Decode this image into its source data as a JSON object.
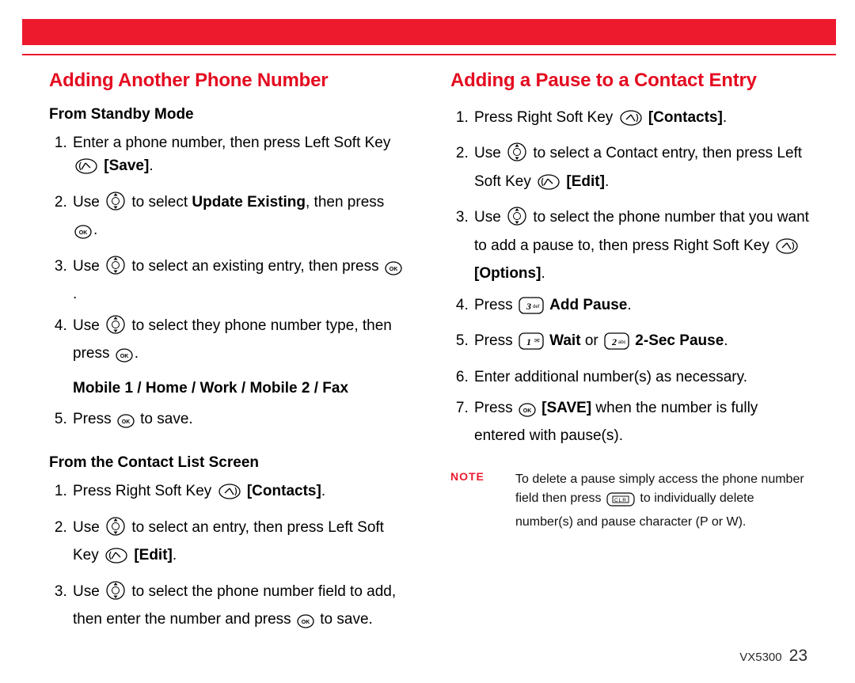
{
  "left": {
    "title": "Adding Another Phone Number",
    "sub1": "From Standby Mode",
    "steps1": {
      "s1a": "Enter a phone number, then press Left Soft Key ",
      "s1_save": "[Save]",
      "s2a": "Use ",
      "s2b": " to select ",
      "s2_update": "Update Existing",
      "s2c": ", then press ",
      "s3a": "Use ",
      "s3b": " to select an existing entry, then press ",
      "s4a": "Use ",
      "s4b": " to select they phone number type, then press ",
      "types": "Mobile 1 / Home / Work / Mobile 2 / Fax",
      "s5a": "Press ",
      "s5b": " to save."
    },
    "sub2": "From the Contact List Screen",
    "steps2": {
      "s1a": "Press Right Soft Key ",
      "s1_contacts": "[Contacts]",
      "s2a": "Use ",
      "s2b": " to select an entry, then press Left Soft Key ",
      "s2_edit": "[Edit]",
      "s3a": "Use ",
      "s3b": " to select the phone number field to add, then enter the number and press ",
      "s3c": " to save."
    }
  },
  "right": {
    "title": "Adding a Pause to a Contact Entry",
    "steps": {
      "s1a": "Press Right Soft Key ",
      "s1_contacts": "[Contacts]",
      "s2a": "Use ",
      "s2b": " to select a Contact entry, then press Left Soft Key ",
      "s2_edit": "[Edit]",
      "s3a": "Use ",
      "s3b": " to select the phone number that you want to add a pause to, then press Right Soft Key ",
      "s3_options": "[Options]",
      "s4a": "Press ",
      "s4_key": "3 def",
      "s4_addpause": " Add Pause",
      "s5a": "Press ",
      "s5_key1": "1",
      "s5_wait": " Wait",
      "s5_or": " or ",
      "s5_key2": "2 abc",
      "s5_2sec": " 2-Sec Pause",
      "s6": "Enter additional number(s) as necessary.",
      "s7a": "Press ",
      "s7_save": " [SAVE]",
      "s7b": " when the number is fully entered with pause(s)."
    },
    "note_label": "NOTE",
    "note_a": "To delete a pause simply access the phone number field then press ",
    "note_b": " to individually delete number(s) and pause character (P or W)."
  },
  "footer": {
    "model": "VX5300",
    "page": "23"
  },
  "icons": {
    "leftsoft": "left-softkey-icon",
    "rightsoft": "right-softkey-icon",
    "nav": "nav-wheel-icon",
    "ok": "ok-key-icon",
    "key3": "keypad-3-icon",
    "key1": "keypad-1-icon",
    "key2": "keypad-2-icon",
    "clr": "clr-key-icon"
  }
}
